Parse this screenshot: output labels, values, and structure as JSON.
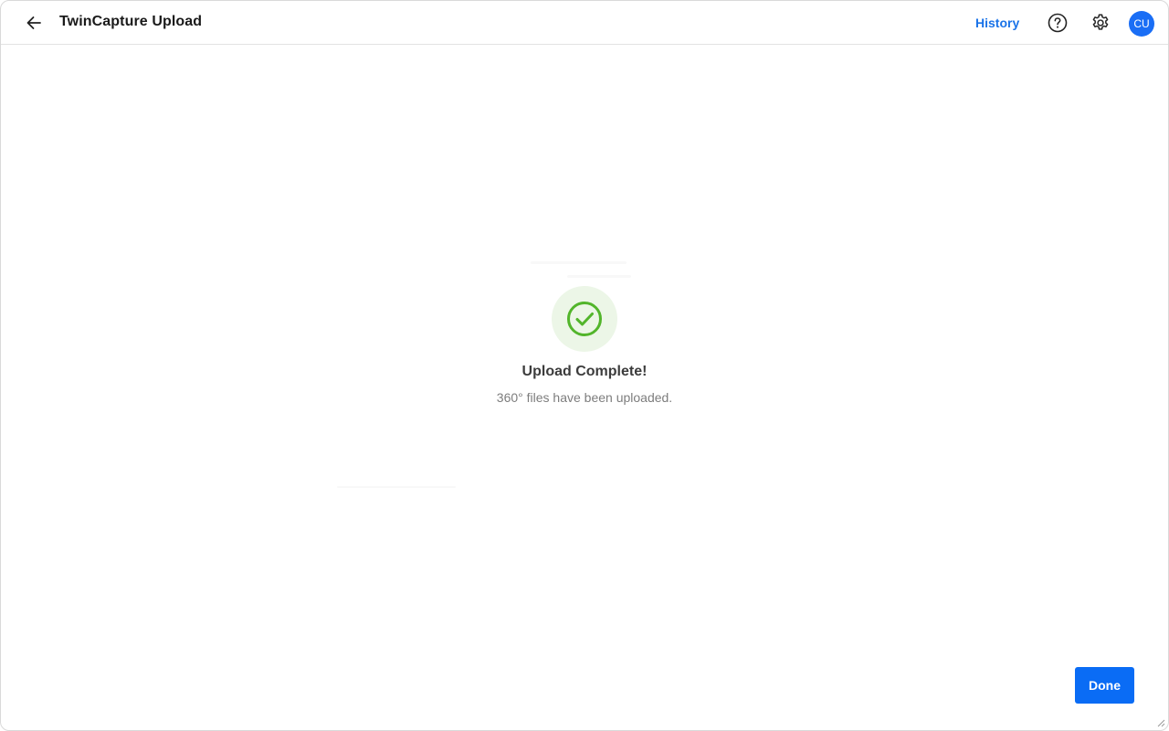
{
  "header": {
    "title": "TwinCapture Upload",
    "history_label": "History",
    "avatar_initials": "CU"
  },
  "status": {
    "title": "Upload Complete!",
    "message": "360° files have been uploaded."
  },
  "footer": {
    "done_label": "Done"
  },
  "icons": {
    "back": "arrow-left-icon",
    "help": "help-circle-icon",
    "settings": "gear-icon",
    "success": "check-circle-icon"
  },
  "colors": {
    "accent": "#1a73e8",
    "button": "#0a6cf5",
    "avatar": "#1a6ef5",
    "success": "#52b52b",
    "success_bg": "#ecf6e7"
  }
}
